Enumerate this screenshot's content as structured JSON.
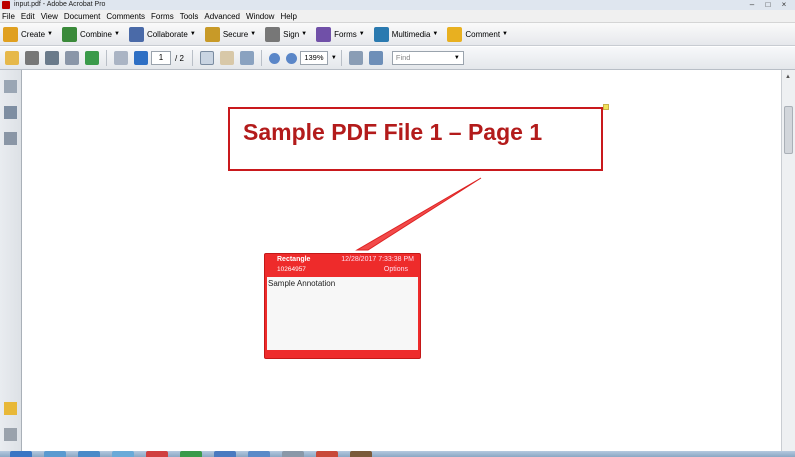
{
  "window": {
    "title": "input.pdf - Adobe Acrobat Pro",
    "minimize": "–",
    "maximize": "□",
    "close": "×"
  },
  "menu": [
    "File",
    "Edit",
    "View",
    "Document",
    "Comments",
    "Forms",
    "Tools",
    "Advanced",
    "Window",
    "Help"
  ],
  "toolbar1": [
    {
      "label": "Create",
      "icon": "create-icon",
      "color": "#e0a020"
    },
    {
      "label": "Combine",
      "icon": "combine-icon",
      "color": "#3a8a3a"
    },
    {
      "label": "Collaborate",
      "icon": "collaborate-icon",
      "color": "#4a6aa8"
    },
    {
      "label": "Secure",
      "icon": "lock-icon",
      "color": "#c89a28"
    },
    {
      "label": "Sign",
      "icon": "pen-icon",
      "color": "#555"
    },
    {
      "label": "Forms",
      "icon": "forms-icon",
      "color": "#7050a8"
    },
    {
      "label": "Multimedia",
      "icon": "multimedia-icon",
      "color": "#2a7ab0"
    },
    {
      "label": "Comment",
      "icon": "comment-icon",
      "color": "#e8b020"
    }
  ],
  "toolbar2": {
    "page_current": "1",
    "page_total": "/ 2",
    "zoom": "139%",
    "find_placeholder": "Find"
  },
  "document": {
    "page_title": "Sample PDF File 1 – Page 1"
  },
  "annotation": {
    "type": "Rectangle",
    "date": "12/28/2017 7:33:38 PM",
    "id": "10264957",
    "options_label": "Options",
    "text": "Sample Annotation"
  },
  "colors": {
    "annotation_red": "#ee2b2b",
    "title_red": "#b31b1b",
    "box_red": "#c9191d"
  }
}
